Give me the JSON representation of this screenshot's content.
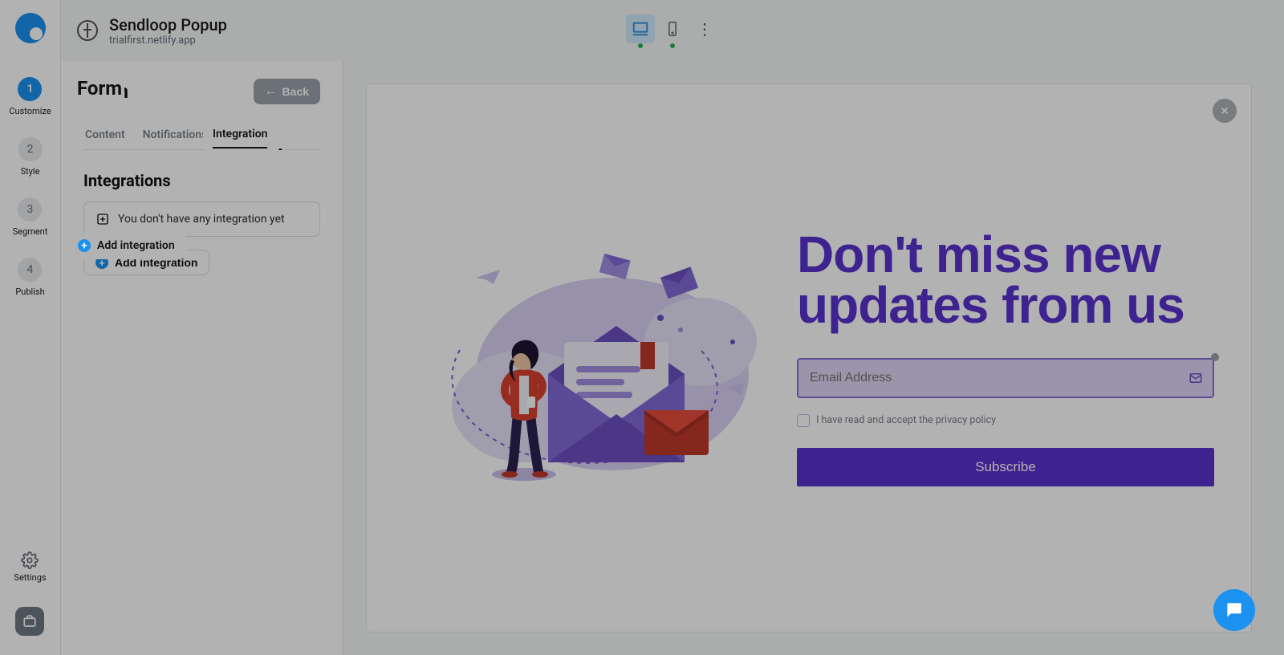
{
  "topbar": {
    "title": "Sendloop Popup",
    "subtitle": "trialfirst.netlify.app"
  },
  "left_rail": {
    "steps": [
      {
        "num": "1",
        "label": "Customize"
      },
      {
        "num": "2",
        "label": "Style"
      },
      {
        "num": "3",
        "label": "Segment"
      },
      {
        "num": "4",
        "label": "Publish"
      }
    ],
    "settings_label": "Settings"
  },
  "panel": {
    "title": "Form",
    "back_label": "Back",
    "tabs": [
      {
        "label": "Content"
      },
      {
        "label": "Notifications"
      },
      {
        "label": "Integration"
      }
    ],
    "section_title": "Integrations",
    "empty_message": "You don't have any integration yet",
    "add_integration_label": "Add integration"
  },
  "popup": {
    "heading": "Don't miss new updates from us",
    "email_placeholder": "Email Address",
    "privacy_text": "I have read and accept the privacy policy",
    "subscribe_label": "Subscribe"
  }
}
